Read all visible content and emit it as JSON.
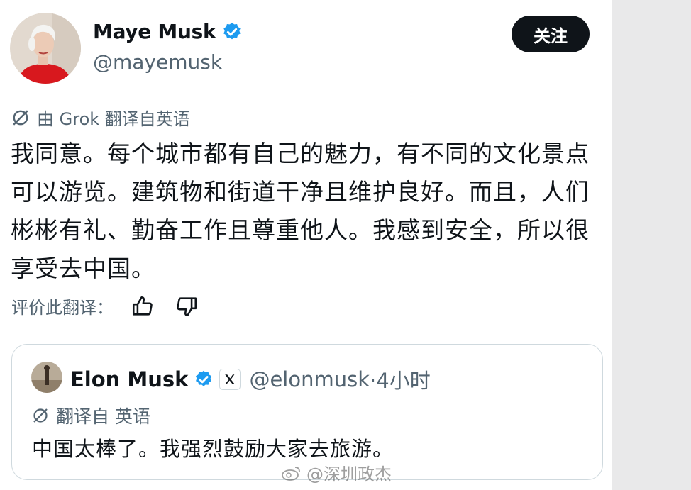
{
  "post": {
    "author_name": "Maye Musk",
    "author_handle": "@mayemusk",
    "follow_label": "关注",
    "translated_by": "由 Grok 翻译自英语",
    "text": "我同意。每个城市都有自己的魅力，有不同的文化景点可以游览。建筑物和街道干净且维护良好。而且，人们彬彬有礼、勤奋工作且尊重他人。我感到安全，所以很享受去中国。",
    "rate_translation_label": "评价此翻译："
  },
  "quoted_post": {
    "author_name": "Elon Musk",
    "author_handle": "@elonmusk",
    "time": "·4小时",
    "translated_label": "翻译自 英语",
    "text": "中国太棒了。我强烈鼓励大家去旅游。"
  },
  "watermark": {
    "text": "@深圳政杰"
  },
  "colors": {
    "verified": "#1d9bf0",
    "text": "#0f1419",
    "secondary": "#536471",
    "button_bg": "#0f1419"
  },
  "icons": [
    "verified-badge-icon",
    "grok-icon",
    "thumbs-up-icon",
    "thumbs-down-icon",
    "x-logo-icon",
    "weibo-icon"
  ]
}
